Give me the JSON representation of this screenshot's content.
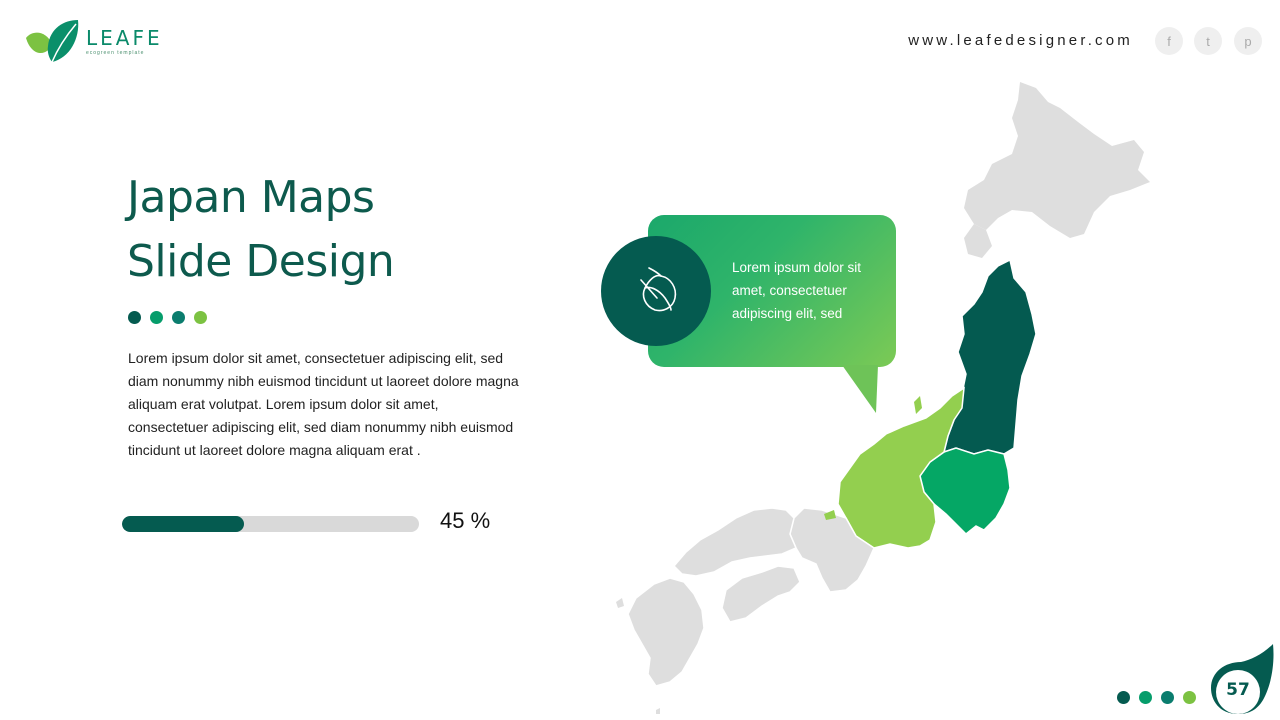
{
  "brand": {
    "name": "LEAFE",
    "tagline": "ecogreen template"
  },
  "header": {
    "website": "www.leafedesigner.com",
    "social": [
      {
        "icon": "facebook-icon",
        "glyph": "f"
      },
      {
        "icon": "twitter-icon",
        "glyph": "t"
      },
      {
        "icon": "pinterest-icon",
        "glyph": "p"
      }
    ]
  },
  "slide": {
    "title_line1": "Japan Maps",
    "title_line2": "Slide Design",
    "body": "Lorem ipsum dolor sit amet, consectetuer adipiscing elit, sed diam nonummy  nibh euismod tincidunt ut laoreet dolore magna aliquam erat volutpat. Lorem ipsum dolor sit amet, consectetuer adipiscing elit, sed diam nonummy  nibh euismod tincidunt ut laoreet dolore magna aliquam erat .",
    "progress": {
      "value": 0.41,
      "label": "45 %"
    },
    "callout": {
      "text": "Lorem ipsum dolor sit amet, consectetuer adipiscing elit, sed",
      "icon": "acorn-icon"
    }
  },
  "footer": {
    "page_number": "57"
  },
  "colors": {
    "dark_teal": "#055b50",
    "green": "#069d6b",
    "teal": "#0b7d6e",
    "lime": "#7cc242",
    "map_gray": "#dedede",
    "map_dark": "#045a50",
    "map_mid": "#05a765",
    "map_light": "#93cf4f"
  },
  "dots": [
    "#055b50",
    "#069d6b",
    "#0b7d6e",
    "#7cc242"
  ]
}
